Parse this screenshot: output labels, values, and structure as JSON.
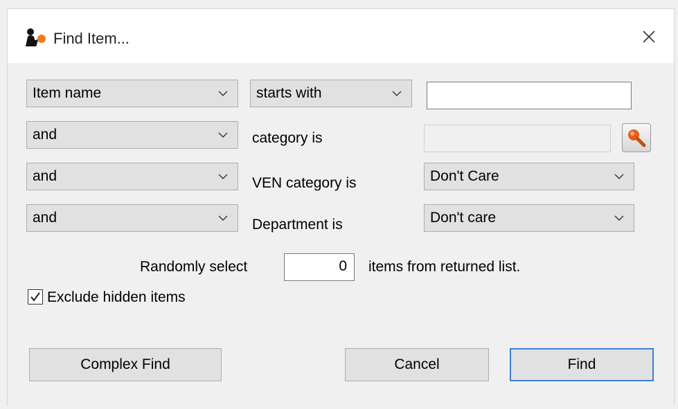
{
  "window": {
    "title": "Find Item..."
  },
  "rows": [
    {
      "field": "Item name",
      "operator": "starts with",
      "value": ""
    },
    {
      "conjunction": "and",
      "label": "category is",
      "value": ""
    },
    {
      "conjunction": "and",
      "label": "VEN category is",
      "value": "Don't Care"
    },
    {
      "conjunction": "and",
      "label": "Department is",
      "value": "Don't care"
    }
  ],
  "random": {
    "prefix": "Randomly select",
    "count": "0",
    "suffix": "items from returned list."
  },
  "exclude_hidden": {
    "label": "Exclude hidden items",
    "checked": true
  },
  "buttons": {
    "complex_find": "Complex Find",
    "cancel": "Cancel",
    "find": "Find"
  },
  "icons": {
    "app": "app-logo-icon",
    "close": "close-icon",
    "lookup": "magnifier-icon",
    "dropdown": "chevron-down-icon",
    "check": "checkmark-icon"
  },
  "colors": {
    "default_button_border": "#3c7fd6",
    "lookup_icon": "#e0601f"
  }
}
